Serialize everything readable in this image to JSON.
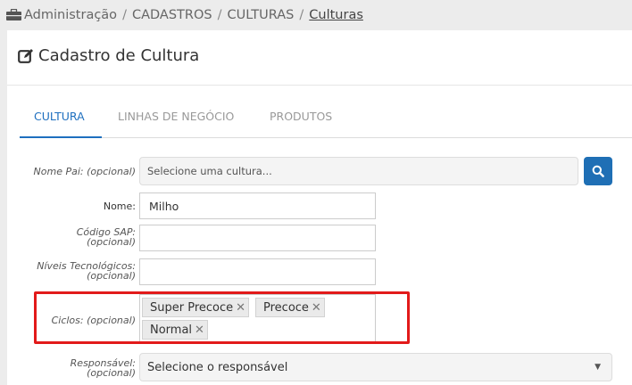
{
  "breadcrumb": {
    "items": [
      "Administração",
      "CADASTROS",
      "CULTURAS",
      "Culturas"
    ],
    "separator": "/"
  },
  "page": {
    "title": "Cadastro de Cultura"
  },
  "tabs": [
    {
      "label": "CULTURA",
      "active": true
    },
    {
      "label": "LINHAS DE NEGÓCIO",
      "active": false
    },
    {
      "label": "PRODUTOS",
      "active": false
    }
  ],
  "form": {
    "nome_pai": {
      "label": "Nome Pai: (opcional)",
      "placeholder": "Selecione uma cultura..."
    },
    "nome": {
      "label": "Nome:",
      "value": "Milho"
    },
    "codigo_sap": {
      "label_line1": "Código SAP:",
      "label_line2": "(opcional)",
      "value": ""
    },
    "niveis": {
      "label_line1": "Níveis Tecnológicos:",
      "label_line2": "(opcional)",
      "value": ""
    },
    "ciclos": {
      "label": "Ciclos: (opcional)",
      "tags": [
        "Super Precoce",
        "Precoce",
        "Normal"
      ],
      "remove_glyph": "✕"
    },
    "responsavel": {
      "label_line1": "Responsável:",
      "label_line2": "(opcional)",
      "placeholder": "Selecione o responsável"
    }
  },
  "colors": {
    "accent": "#1e6fbf",
    "highlight": "#e21a1a",
    "background": "#ececec"
  },
  "icons": {
    "breadcrumb": "briefcase-icon",
    "title": "edit-icon",
    "search": "search-icon",
    "dropdown": "caret-down-icon"
  },
  "dropdown_glyph": "▼"
}
